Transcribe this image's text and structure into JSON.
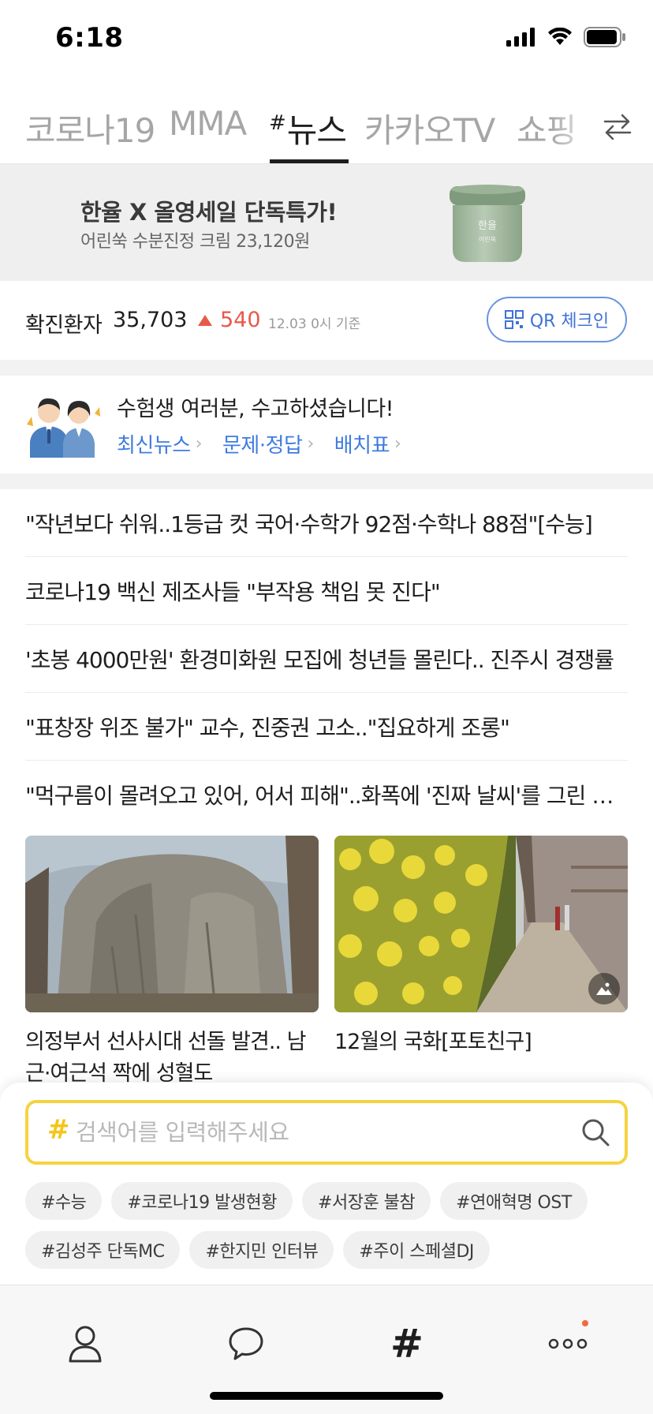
{
  "status_bar": {
    "time": "6:18"
  },
  "tabs": [
    {
      "label": "코로나19",
      "hash": ""
    },
    {
      "label": "MMA",
      "hash": ""
    },
    {
      "label": "뉴스",
      "hash": "#"
    },
    {
      "label": "카카오TV",
      "hash": ""
    },
    {
      "label": "쇼핑",
      "hash": ""
    }
  ],
  "ad": {
    "title": "한율 X 올영세일 단독특가!",
    "subtitle": "어린쑥 수분진정 크림 23,120원",
    "product_label": "한율",
    "product_sub": "어린쑥"
  },
  "covid": {
    "label": "확진환자",
    "count": "35,703",
    "delta": "540",
    "date": "12.03 0시 기준",
    "qr_label": "QR 체크인",
    "delta_color": "#e8584b"
  },
  "exam_banner": {
    "title": "수험생 여러분, 수고하셨습니다!",
    "links": [
      "최신뉴스",
      "문제·정답",
      "배치표"
    ]
  },
  "news": [
    "\"작년보다 쉬워..1등급 컷 국어·수학가 92점·수학나 88점\"[수능]",
    "코로나19 백신 제조사들 \"부작용 책임 못 진다\"",
    "'초봉 4000만원' 환경미화원 모집에 청년들 몰린다.. 진주시 경쟁률",
    "\"표창장 위조 불가\" 교수, 진중권 고소..\"집요하게 조롱\"",
    "\"먹구름이 몰려오고 있어, 어서 피해\"..화폭에 '진짜 날씨'를 그린 화가"
  ],
  "cards": [
    {
      "caption": "의정부서 선사시대 선돌 발견.. 남근·여근석 짝에 성혈도"
    },
    {
      "caption": "12월의 국화[포토친구]"
    }
  ],
  "search": {
    "hash": "#",
    "placeholder": "검색어를 입력해주세요",
    "chips_row1": [
      "#수능",
      "#코로나19 발생현황",
      "#서장훈 불참",
      "#연애혁명 OST"
    ],
    "chips_row2": [
      "#김성주 단독MC",
      "#한지민 인터뷰",
      "#주이 스페셜DJ"
    ]
  },
  "bottom_nav": {
    "items": [
      "friends-icon",
      "chat-icon",
      "hash-icon",
      "more-icon"
    ],
    "hash_symbol": "#"
  },
  "colors": {
    "accent_blue": "#3f7be0",
    "search_border": "#f5d33f",
    "alert_red": "#e8584b"
  }
}
